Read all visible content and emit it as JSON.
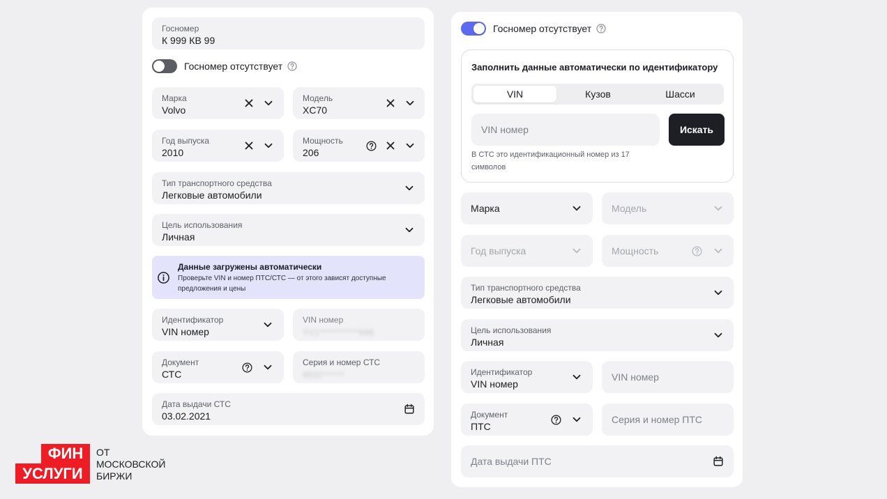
{
  "colors": {
    "accent": "#5b6bef",
    "toggle_off": "#5a5d63",
    "notice_bg": "#e3e3fb",
    "button_dark": "#1d1f25",
    "brand_red": "#ee1c25"
  },
  "left": {
    "plate": {
      "label": "Госномер",
      "value": "К 999 КВ 99"
    },
    "toggle": {
      "label": "Госномер отсутствует",
      "on": false
    },
    "make": {
      "label": "Марка",
      "value": "Volvo"
    },
    "model": {
      "label": "Модель",
      "value": "XC70"
    },
    "year": {
      "label": "Год выпуска",
      "value": "2010"
    },
    "power": {
      "label": "Мощность",
      "value": "206"
    },
    "vehicle_type": {
      "label": "Тип транспортного средства",
      "value": "Легковые автомобили"
    },
    "purpose": {
      "label": "Цель использования",
      "value": "Личная"
    },
    "notice": {
      "title": "Данные загружены автоматически",
      "text_line1": "Проверьте VIN и номер ПТС/СТС — от этого зависят доступные",
      "text_line2": "предложения и цены"
    },
    "identifier": {
      "label": "Идентификатор",
      "value": "VIN номер"
    },
    "vin": {
      "label": "VIN номер",
      "masked": "YV1***********886"
    },
    "document": {
      "label": "Документ",
      "value": "СТС"
    },
    "sts_number": {
      "label": "Серия и номер СТС",
      "masked": "9932******"
    },
    "issue_date": {
      "label": "Дата выдачи СТС",
      "value": "03.02.2021"
    }
  },
  "right": {
    "toggle": {
      "label": "Госномер отсутствует",
      "on": true
    },
    "autofill": {
      "title": "Заполнить данные автоматически по идентификатору",
      "tabs": [
        "VIN",
        "Кузов",
        "Шасси"
      ],
      "active_tab": "VIN",
      "input_placeholder": "VIN номер",
      "search_button": "Искать",
      "hint_line1": "В СТС это идентификационный номер из 17",
      "hint_line2": "символов"
    },
    "make": {
      "placeholder": "Марка"
    },
    "model": {
      "placeholder": "Модель"
    },
    "year": {
      "placeholder": "Год выпуска"
    },
    "power": {
      "placeholder": "Мощность"
    },
    "vehicle_type": {
      "label": "Тип транспортного средства",
      "value": "Легковые автомобили"
    },
    "purpose": {
      "label": "Цель использования",
      "value": "Личная"
    },
    "identifier": {
      "label": "Идентификатор",
      "value": "VIN номер"
    },
    "vin": {
      "placeholder": "VIN номер"
    },
    "document": {
      "label": "Документ",
      "value": "ПТС"
    },
    "pts_number": {
      "placeholder": "Серия и номер ПТС"
    },
    "issue_date": {
      "placeholder": "Дата выдачи ПТС"
    }
  },
  "logo": {
    "line1": "ФИН",
    "line2": "УСЛУГИ",
    "tag1": "ОТ",
    "tag2": "МОСКОВСКОЙ",
    "tag3": "БИРЖИ"
  }
}
